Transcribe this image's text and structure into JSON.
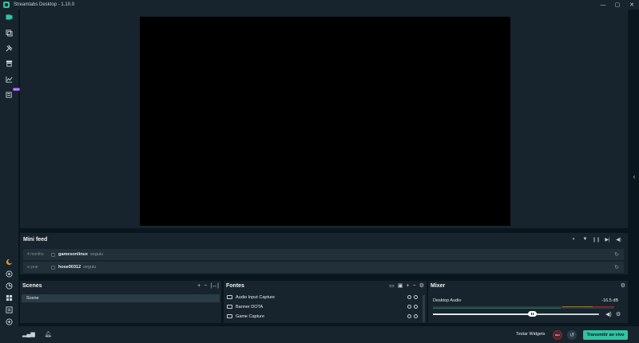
{
  "window": {
    "title": "Streamlabs Desktop - 1.10.0",
    "controls": [
      "—",
      "▢",
      "✕"
    ]
  },
  "leftnav": {
    "top_icons": [
      "editor-icon",
      "themes-icon",
      "app-store-icon",
      "highlighter-icon",
      "dashboard-icon",
      "alert-box-icon"
    ],
    "new_badge": "NEW",
    "bottom_icons": [
      "theme-night-icon",
      "help-icon",
      "settings-link-icon",
      "layout-icon",
      "logout-icon",
      "login-icon",
      "gear-icon"
    ]
  },
  "minifeed": {
    "title": "Mini feed",
    "items": [
      {
        "time": "4 months",
        "user": "gamesonlinux",
        "action": "seguiu"
      },
      {
        "time": "a year",
        "user": "hose00312",
        "action": "seguiu"
      }
    ]
  },
  "scenes": {
    "title": "Scenes",
    "items": [
      "Scene"
    ]
  },
  "sources": {
    "title": "Fontes",
    "items": [
      "Audio Input Capture",
      "Banner DOTA",
      "Game Capture"
    ]
  },
  "mixer": {
    "title": "Mixer",
    "channel": "Desktop Audio",
    "db": "-16.5 dB",
    "volume_fraction": 0.6
  },
  "footer": {
    "testar": "Testar Widgets",
    "rec": "REC",
    "live": "Transmitir ao vivo"
  },
  "colors": {
    "accent": "#31c3a2",
    "panel": "#17242d",
    "background": "#09161d"
  }
}
